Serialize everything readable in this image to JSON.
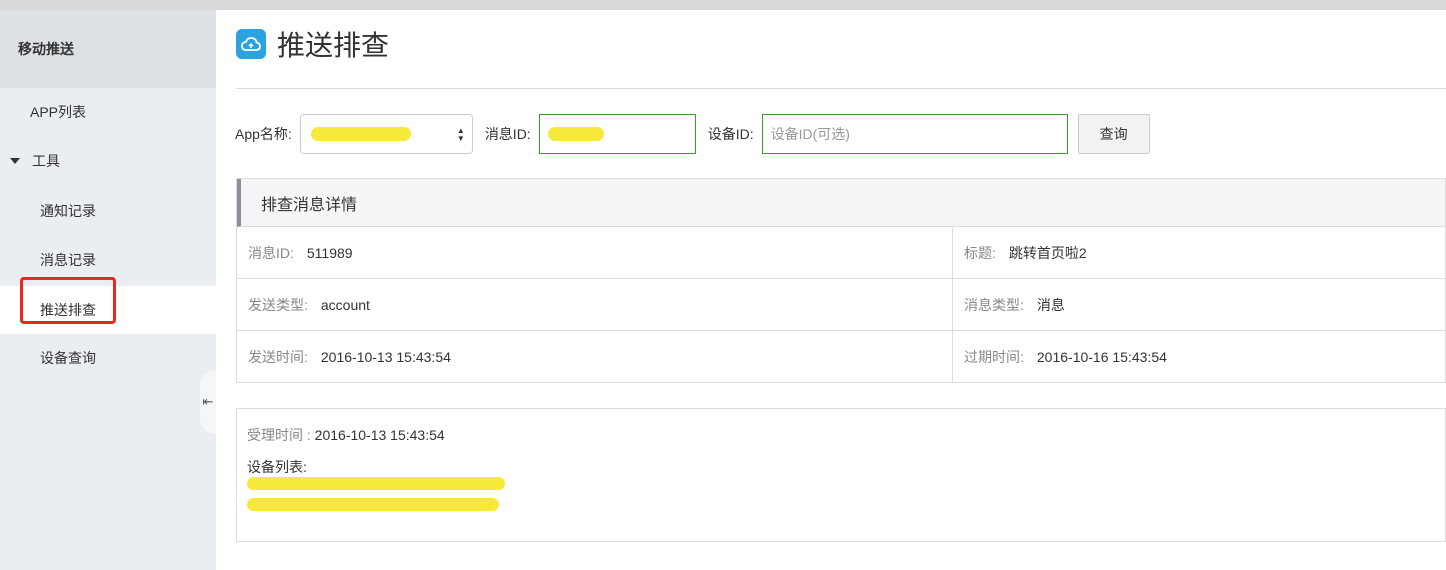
{
  "sidebar": {
    "title": "移动推送",
    "items": [
      {
        "label": "APP列表"
      },
      {
        "label": "工具"
      },
      {
        "label": "通知记录"
      },
      {
        "label": "消息记录"
      },
      {
        "label": "推送排查"
      },
      {
        "label": "设备查询"
      }
    ],
    "collapse_glyph": "⇤"
  },
  "page": {
    "title": "推送排查",
    "icon": "cloud-push-icon"
  },
  "form": {
    "app_label": "App名称:",
    "msgid_label": "消息ID:",
    "device_label": "设备ID:",
    "device_placeholder": "设备ID(可选)",
    "query_button": "查询"
  },
  "details": {
    "header": "排查消息详情",
    "rows": [
      {
        "left_label": "消息ID:",
        "left_value": "511989",
        "right_label": "标题:",
        "right_value": "跳转首页啦2"
      },
      {
        "left_label": "发送类型:",
        "left_value": "account",
        "right_label": "消息类型:",
        "right_value": "消息"
      },
      {
        "left_label": "发送时间:",
        "left_value": "2016-10-13 15:43:54",
        "right_label": "过期时间:",
        "right_value": "2016-10-16 15:43:54"
      }
    ]
  },
  "receipt": {
    "accept_label": "受理时间 :",
    "accept_value": "2016-10-13 15:43:54",
    "device_list_label": "设备列表:"
  },
  "colors": {
    "accent": "#2aa3e0",
    "highlight": "#e8281f",
    "input_border": "#3c9a2f",
    "redaction": "#f7e93a"
  }
}
